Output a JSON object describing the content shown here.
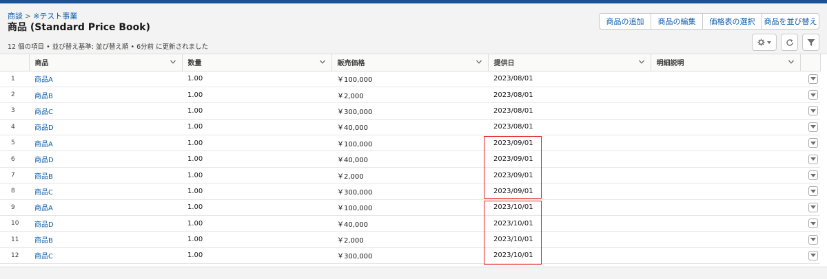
{
  "breadcrumb": {
    "parent": "商談",
    "current": "※テスト事業"
  },
  "page_title": "商品 (Standard Price Book)",
  "status_line": "12 個の項目 • 並び替え基準: 並び替え順 • 6分前 に更新されました",
  "actions": [
    {
      "label": "商品の追加"
    },
    {
      "label": "商品の編集"
    },
    {
      "label": "価格表の選択"
    },
    {
      "label": "商品を並び替え"
    }
  ],
  "icons": [
    "gear-icon",
    "chevron-down-icon",
    "refresh-icon",
    "filter-icon",
    "row-menu-icon"
  ],
  "columns": [
    "商品",
    "数量",
    "販売価格",
    "提供日",
    "明細説明"
  ],
  "rows": [
    {
      "num": "1",
      "product": "商品A",
      "qty": "1.00",
      "price": "￥100,000",
      "date": "2023/08/01",
      "desc": ""
    },
    {
      "num": "2",
      "product": "商品B",
      "qty": "1.00",
      "price": "￥2,000",
      "date": "2023/08/01",
      "desc": ""
    },
    {
      "num": "3",
      "product": "商品C",
      "qty": "1.00",
      "price": "￥300,000",
      "date": "2023/08/01",
      "desc": ""
    },
    {
      "num": "4",
      "product": "商品D",
      "qty": "1.00",
      "price": "￥40,000",
      "date": "2023/08/01",
      "desc": ""
    },
    {
      "num": "5",
      "product": "商品A",
      "qty": "1.00",
      "price": "￥100,000",
      "date": "2023/09/01",
      "desc": ""
    },
    {
      "num": "6",
      "product": "商品D",
      "qty": "1.00",
      "price": "￥40,000",
      "date": "2023/09/01",
      "desc": ""
    },
    {
      "num": "7",
      "product": "商品B",
      "qty": "1.00",
      "price": "￥2,000",
      "date": "2023/09/01",
      "desc": ""
    },
    {
      "num": "8",
      "product": "商品C",
      "qty": "1.00",
      "price": "￥300,000",
      "date": "2023/09/01",
      "desc": ""
    },
    {
      "num": "9",
      "product": "商品A",
      "qty": "1.00",
      "price": "￥100,000",
      "date": "2023/10/01",
      "desc": ""
    },
    {
      "num": "10",
      "product": "商品D",
      "qty": "1.00",
      "price": "￥40,000",
      "date": "2023/10/01",
      "desc": ""
    },
    {
      "num": "11",
      "product": "商品B",
      "qty": "1.00",
      "price": "￥2,000",
      "date": "2023/10/01",
      "desc": ""
    },
    {
      "num": "12",
      "product": "商品C",
      "qty": "1.00",
      "price": "￥300,000",
      "date": "2023/10/01",
      "desc": ""
    }
  ],
  "colors": {
    "brand_bar": "#1b5297",
    "link": "#0b5cab",
    "highlight_box": "#e01e1e"
  }
}
